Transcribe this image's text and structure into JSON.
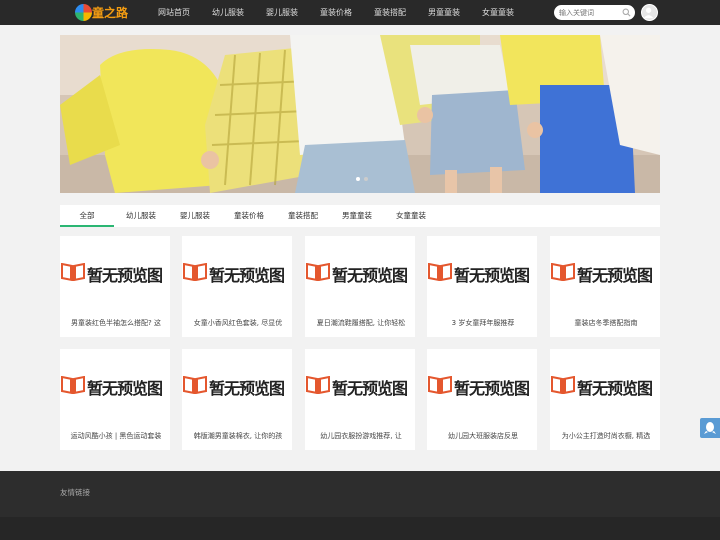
{
  "header": {
    "logo_text": "童之路",
    "nav": [
      "网站首页",
      "幼儿服装",
      "婴儿服装",
      "童装价格",
      "童装搭配",
      "男童童装",
      "女童童装"
    ],
    "search_placeholder": "输入关键词"
  },
  "banner": {
    "slide_count": 2,
    "active_slide": 1
  },
  "tabs": {
    "items": [
      "全部",
      "幼儿服装",
      "婴儿服装",
      "童装价格",
      "童装搭配",
      "男童童装",
      "女童童装"
    ],
    "active": "全部"
  },
  "cards": {
    "placeholder_text": "暂无预览图",
    "items": [
      {
        "title": "男童装红色半袖怎么搭配? 这"
      },
      {
        "title": "女童小香风红色套装, 尽显优"
      },
      {
        "title": "夏日潮流鞋履搭配, 让你轻松"
      },
      {
        "title": "3 岁女童拜年服推荐"
      },
      {
        "title": "童装店冬季搭配指南"
      },
      {
        "title": "运动风酷小孩 | 黑色运动套装"
      },
      {
        "title": "韩版潮男童装棉衣, 让你的孩"
      },
      {
        "title": "幼儿园衣服扮游戏推荐, 让"
      },
      {
        "title": "幼儿园大班服装店反思"
      },
      {
        "title": "为小公主打造时尚衣橱, 精选"
      }
    ]
  },
  "footer": {
    "friend_links_label": "友情链接"
  },
  "colors": {
    "topbar": "#292929",
    "accent": "#2bb673",
    "logo": "#f39c12",
    "placeholder_red": "#e4572e"
  }
}
